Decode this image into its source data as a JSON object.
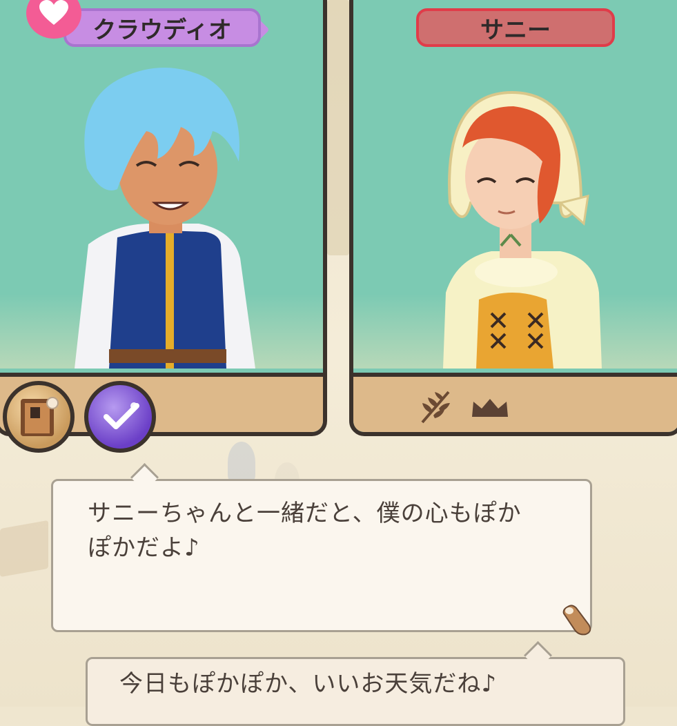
{
  "left_panel": {
    "name": "クラウディオ",
    "tag_color": "#c78de3",
    "badge_icon": "heart-icon"
  },
  "right_panel": {
    "name": "サニー",
    "tag_color": "#cf6f6f",
    "shelf_icons": [
      "wheat-icon",
      "crown-icon"
    ]
  },
  "action_buttons": [
    {
      "icon": "album-icon"
    },
    {
      "icon": "check-icon"
    }
  ],
  "dialogue": {
    "main_line_1": "サニーちゃんと一緒だと、僕の心もぽか",
    "main_line_2": "ぽかだよ♪",
    "second": "今日もぽかぽか、いいお天気だね♪"
  },
  "colors": {
    "panel_bg": "#7ccab3",
    "shelf_bg": "#ddb98a",
    "frame": "#3b322c"
  }
}
